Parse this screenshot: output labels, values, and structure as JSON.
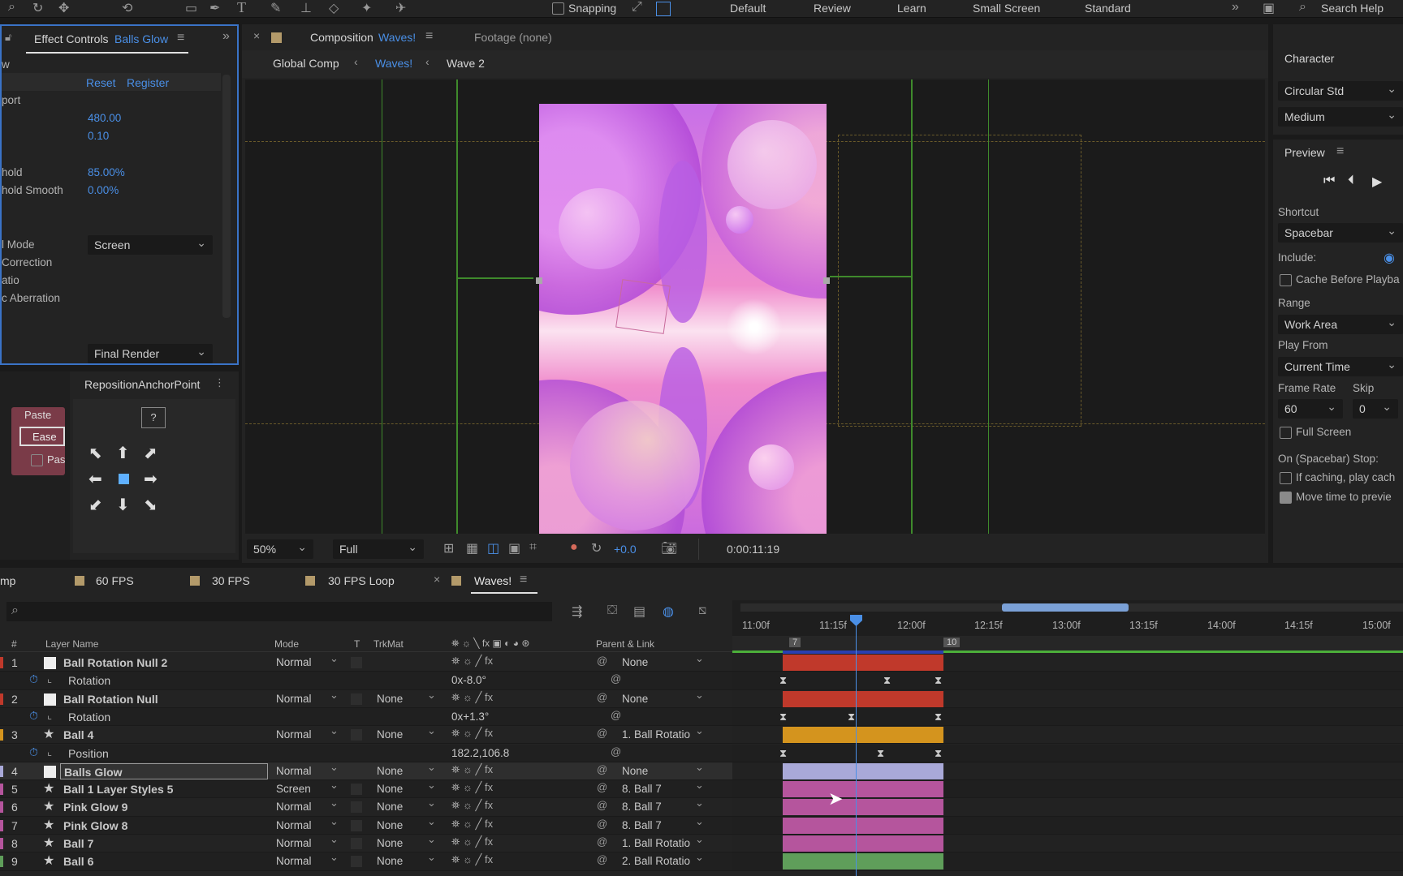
{
  "topbar": {
    "snapping": "Snapping",
    "workspaces": [
      "Default",
      "Review",
      "Learn",
      "Small Screen",
      "Standard"
    ],
    "search": "Search Help"
  },
  "effect_controls": {
    "title": "Effect Controls",
    "layer": "Balls Glow",
    "reset": "Reset",
    "register": "Register",
    "rows": [
      {
        "label": "w",
        "value": ""
      },
      {
        "label": "port",
        "value": ""
      },
      {
        "label": "",
        "value": "480.00"
      },
      {
        "label": "",
        "value": "0.10"
      },
      {
        "label": "hold",
        "value": "85.00%"
      },
      {
        "label": "hold Smooth",
        "value": "0.00%"
      },
      {
        "label": "l Mode",
        "value": "Screen"
      },
      {
        "label": "Correction",
        "value": ""
      },
      {
        "label": "atio",
        "value": ""
      },
      {
        "label": "c Aberration",
        "value": ""
      }
    ],
    "final_render": "Final Render"
  },
  "reposition": {
    "title": "RepositionAnchorPoint",
    "help": "?",
    "paste": "Paste",
    "ease": "Ease",
    "pas": "Pas"
  },
  "composition": {
    "title": "Composition",
    "name": "Waves!",
    "footage": "Footage (none)",
    "breadcrumbs": [
      "Global Comp",
      "Waves!",
      "Wave 2"
    ],
    "zoom": "50%",
    "resolution": "Full",
    "exposure": "+0.0",
    "timecode": "0:00:11:19"
  },
  "character": {
    "title": "Character",
    "font": "Circular Std",
    "weight": "Medium"
  },
  "preview": {
    "title": "Preview",
    "shortcut_label": "Shortcut",
    "shortcut": "Spacebar",
    "include": "Include:",
    "cache": "Cache Before Playba",
    "range_label": "Range",
    "range": "Work Area",
    "play_from_label": "Play From",
    "play_from": "Current Time",
    "frame_rate_label": "Frame Rate",
    "skip_label": "Skip",
    "frame_rate": "60",
    "skip": "0",
    "full_screen": "Full Screen",
    "stop_label": "On (Spacebar) Stop:",
    "if_caching": "If caching, play cach",
    "move_time": "Move time to previe"
  },
  "timeline": {
    "tabs": [
      "mp",
      "60 FPS",
      "30 FPS",
      "30 FPS Loop",
      "Waves!"
    ],
    "columns": {
      "num": "#",
      "name": "Layer Name",
      "mode": "Mode",
      "t": "T",
      "trkmat": "TrkMat",
      "parent": "Parent & Link"
    },
    "ruler": [
      "11:00f",
      "11:15f",
      "12:00f",
      "12:15f",
      "13:00f",
      "13:15f",
      "14:00f",
      "14:15f",
      "15:00f"
    ],
    "markers": [
      "7",
      "10"
    ],
    "rows": [
      {
        "num": "1",
        "name": "Ball Rotation Null 2",
        "mode": "Normal",
        "trkmat": "",
        "parent": "None",
        "kind": "layer",
        "color": "#c0392b"
      },
      {
        "num": "",
        "name": "Rotation",
        "value": "0x-8.0°",
        "kind": "prop"
      },
      {
        "num": "2",
        "name": "Ball Rotation Null",
        "mode": "Normal",
        "trkmat": "None",
        "parent": "None",
        "kind": "layer",
        "color": "#c0392b"
      },
      {
        "num": "",
        "name": "Rotation",
        "value": "0x+1.3°",
        "kind": "prop"
      },
      {
        "num": "3",
        "name": "Ball 4",
        "mode": "Normal",
        "trkmat": "None",
        "parent": "1. Ball Rotatio",
        "kind": "layer",
        "color": "#d4941e"
      },
      {
        "num": "",
        "name": "Position",
        "value": "182.2,106.8",
        "kind": "prop"
      },
      {
        "num": "4",
        "name": "Balls Glow",
        "mode": "Normal",
        "trkmat": "None",
        "parent": "None",
        "kind": "layer",
        "color": "#a9a9d8"
      },
      {
        "num": "5",
        "name": "Ball 1 Layer Styles 5",
        "mode": "Screen",
        "trkmat": "None",
        "parent": "8. Ball 7",
        "kind": "layer",
        "color": "#b5559d"
      },
      {
        "num": "6",
        "name": "Pink Glow 9",
        "mode": "Normal",
        "trkmat": "None",
        "parent": "8. Ball 7",
        "kind": "layer",
        "color": "#b5559d"
      },
      {
        "num": "7",
        "name": "Pink Glow 8",
        "mode": "Normal",
        "trkmat": "None",
        "parent": "8. Ball 7",
        "kind": "layer",
        "color": "#b5559d"
      },
      {
        "num": "8",
        "name": "Ball 7",
        "mode": "Normal",
        "trkmat": "None",
        "parent": "1. Ball Rotatio",
        "kind": "layer",
        "color": "#b5559d"
      },
      {
        "num": "9",
        "name": "Ball 6",
        "mode": "Normal",
        "trkmat": "None",
        "parent": "2. Ball Rotatio",
        "kind": "layer",
        "color": "#5f9e5a"
      }
    ]
  }
}
